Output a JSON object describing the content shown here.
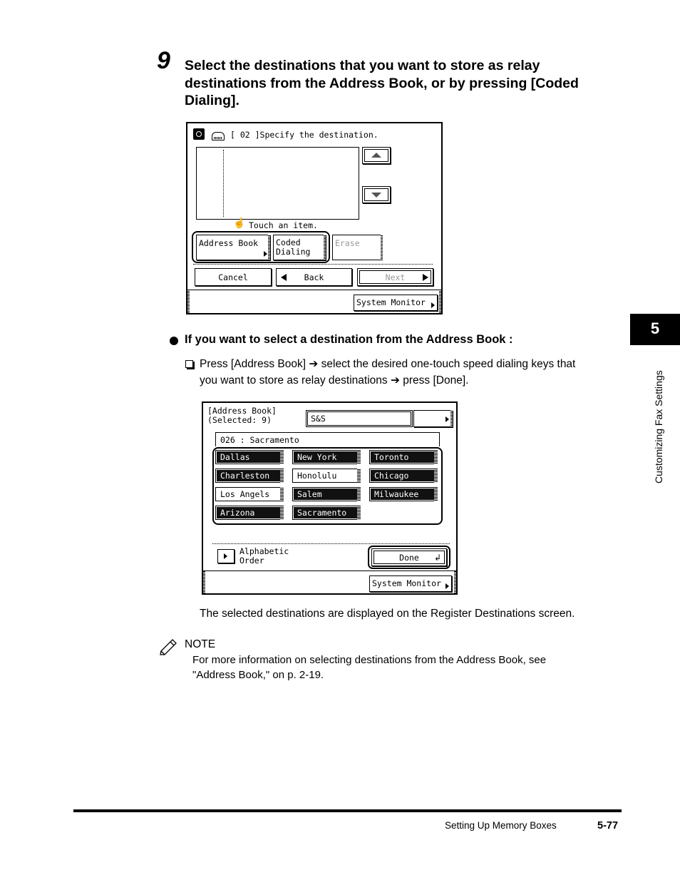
{
  "step": {
    "number": "9",
    "text": "Select the destinations that you want to store as relay destinations from the Address Book, or by pressing [Coded Dialing]."
  },
  "screen1": {
    "header": "[ 02 ]Specify the destination.",
    "hint": "Touch an item.",
    "buttons": {
      "address_book": "Address Book",
      "coded_dialing_1": "Coded",
      "coded_dialing_2": "Dialing",
      "erase": "Erase",
      "cancel": "Cancel",
      "back": "Back",
      "next": "Next",
      "system_monitor": "System Monitor"
    }
  },
  "bullet": {
    "heading": "If you want to select a destination from the Address Book :",
    "instruction_line1": "Press [Address Book] ➔ select the desired one-touch speed dialing keys that",
    "instruction_line2": "you want to store as relay destinations ➔ press [Done]."
  },
  "screen2": {
    "title_line1": "[Address Book]",
    "title_line2": "(Selected: 9)",
    "group": "S&S",
    "detail": "026 : Sacramento",
    "keys": [
      {
        "label": "Dallas",
        "selected": true
      },
      {
        "label": "New York",
        "selected": true
      },
      {
        "label": "Toronto",
        "selected": true
      },
      {
        "label": "Charleston",
        "selected": true
      },
      {
        "label": "Honolulu",
        "selected": false
      },
      {
        "label": "Chicago",
        "selected": true
      },
      {
        "label": "Los Angels",
        "selected": false
      },
      {
        "label": "Salem",
        "selected": true
      },
      {
        "label": "Milwaukee",
        "selected": true
      },
      {
        "label": "Arizona",
        "selected": true
      },
      {
        "label": "Sacramento",
        "selected": true
      }
    ],
    "alphabetic_1": "Alphabetic",
    "alphabetic_2": "Order",
    "done": "Done",
    "system_monitor": "System Monitor"
  },
  "result_text": "The selected destinations are displayed on the Register Destinations screen.",
  "note": {
    "label": "NOTE",
    "line1": "For more information on selecting destinations from the Address Book, see",
    "line2": "\"Address Book,\" on p. 2-19."
  },
  "side_tab": {
    "number": "5",
    "label": "Customizing Fax Settings"
  },
  "footer": {
    "section": "Setting Up Memory Boxes",
    "page": "5-77"
  }
}
